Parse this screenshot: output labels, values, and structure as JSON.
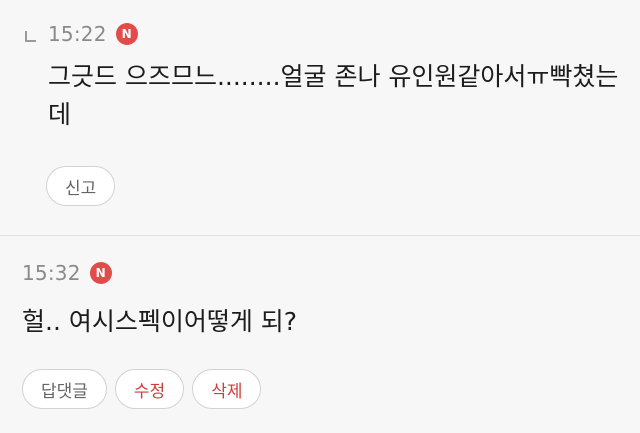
{
  "comments": [
    {
      "time": "15:22",
      "badge": "N",
      "text": "그긋드 으즈므느........얼굴 존나 유인원같아서ㅠ빡쳤는데",
      "actions": {
        "report_label": "신고"
      }
    },
    {
      "time": "15:32",
      "badge": "N",
      "text": "헐.. 여시스펙이어떻게 되?",
      "actions": {
        "reply_label": "답댓글",
        "edit_label": "수정",
        "delete_label": "삭제"
      }
    }
  ],
  "colors": {
    "badge": "#e34b4b",
    "danger_text": "#d23c3c",
    "background": "#f7f7f7"
  },
  "icons": {
    "reply_indicator": "reply-arrow-icon",
    "new_badge": "new-badge-icon"
  }
}
